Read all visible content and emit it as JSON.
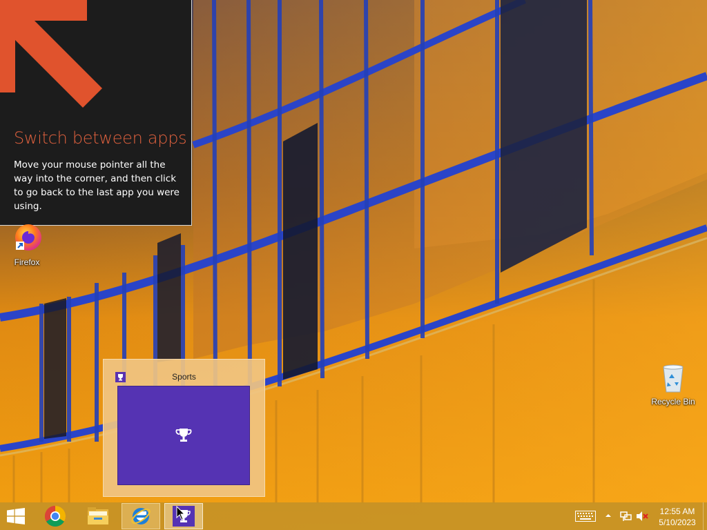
{
  "tip": {
    "title": "Switch between apps",
    "body": "Move your mouse pointer all the way into the corner, and then click to go back to the last app you were using.",
    "arrow_icon": "corner-arrow-icon",
    "accent_color": "#e0613e"
  },
  "desktop": {
    "icons": [
      {
        "label": "Firefox",
        "icon": "firefox-icon"
      },
      {
        "label": "Recycle Bin",
        "icon": "recycle-bin-icon"
      }
    ]
  },
  "thumbnail": {
    "title": "Sports",
    "icon": "trophy-icon",
    "tile_color": "#5533b3"
  },
  "taskbar": {
    "buttons": [
      {
        "name": "Start",
        "icon": "windows-logo-icon"
      },
      {
        "name": "Google Chrome",
        "icon": "chrome-icon"
      },
      {
        "name": "File Explorer",
        "icon": "folder-icon"
      },
      {
        "name": "Internet Explorer",
        "icon": "ie-icon"
      },
      {
        "name": "Sports",
        "icon": "trophy-icon"
      }
    ],
    "tray": {
      "time": "12:55 AM",
      "date": "5/10/2023"
    },
    "color": "#c69226"
  }
}
